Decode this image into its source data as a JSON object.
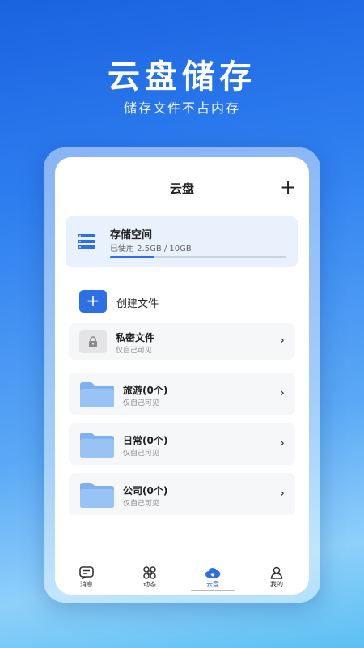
{
  "hero": {
    "title": "云盘储存",
    "subtitle": "储存文件不占内存"
  },
  "header": {
    "title": "云盘",
    "add_label": "+"
  },
  "storage": {
    "title": "存储空间",
    "usage": "已使用 2.5GB / 10GB",
    "used_fraction": 0.25
  },
  "create": {
    "icon_label": "+",
    "label": "创建文件"
  },
  "private": {
    "title": "私密文件",
    "subtitle": "仅自己可见",
    "chevron": "›"
  },
  "folders": [
    {
      "name": "旅游(0个)",
      "subtitle": "仅自己可见",
      "chevron": "›"
    },
    {
      "name": "日常(0个)",
      "subtitle": "仅自己可见",
      "chevron": "›"
    },
    {
      "name": "公司(0个)",
      "subtitle": "仅自己可见",
      "chevron": "›"
    }
  ],
  "tabs": [
    {
      "label": "消息",
      "icon": "message-icon"
    },
    {
      "label": "动态",
      "icon": "command-icon"
    },
    {
      "label": "云盘",
      "icon": "cloud-icon",
      "active": true
    },
    {
      "label": "我的",
      "icon": "user-icon"
    }
  ],
  "colors": {
    "accent": "#2f6fe6",
    "folder": "#7fb0ef",
    "card_bg": "#e9f1fd"
  }
}
